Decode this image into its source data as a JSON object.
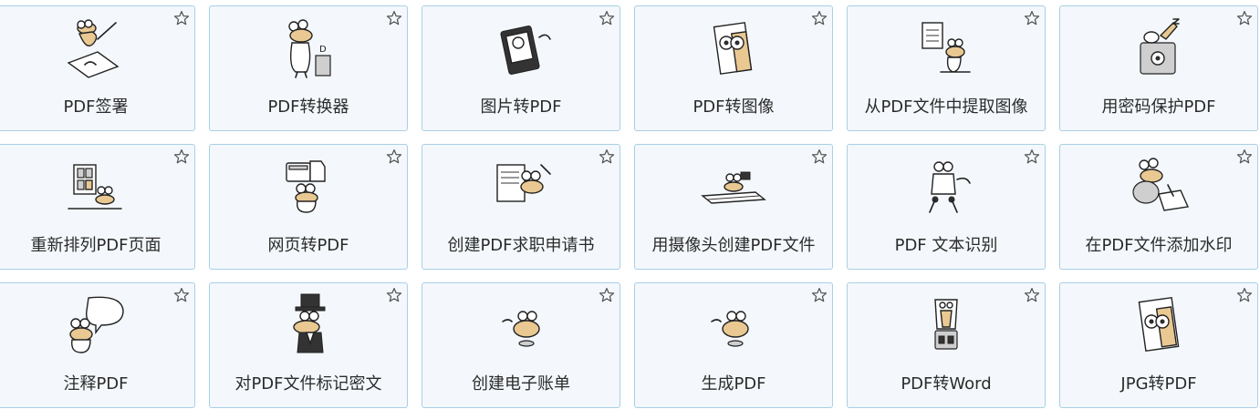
{
  "tools": [
    {
      "label": "PDF签署",
      "icon": "pdf-sign-icon"
    },
    {
      "label": "PDF转换器",
      "icon": "pdf-converter-icon"
    },
    {
      "label": "图片转PDF",
      "icon": "image-to-pdf-icon"
    },
    {
      "label": "PDF转图像",
      "icon": "pdf-to-image-icon"
    },
    {
      "label": "从PDF文件中提取图像",
      "icon": "extract-images-icon"
    },
    {
      "label": "用密码保护PDF",
      "icon": "password-protect-icon"
    },
    {
      "label": "重新排列PDF页面",
      "icon": "rearrange-pages-icon"
    },
    {
      "label": "网页转PDF",
      "icon": "webpage-to-pdf-icon"
    },
    {
      "label": "创建PDF求职申请书",
      "icon": "job-application-icon"
    },
    {
      "label": "用摄像头创建PDF文件",
      "icon": "webcam-pdf-icon"
    },
    {
      "label": "PDF 文本识别",
      "icon": "ocr-icon"
    },
    {
      "label": "在PDF文件添加水印",
      "icon": "watermark-icon"
    },
    {
      "label": "注释PDF",
      "icon": "annotate-icon"
    },
    {
      "label": "对PDF文件标记密文",
      "icon": "redact-icon"
    },
    {
      "label": "创建电子账单",
      "icon": "create-invoice-icon"
    },
    {
      "label": "生成PDF",
      "icon": "generate-pdf-icon"
    },
    {
      "label": "PDF转Word",
      "icon": "pdf-to-word-icon"
    },
    {
      "label": "JPG转PDF",
      "icon": "jpg-to-pdf-icon"
    }
  ],
  "favorite_icon": "star-outline-icon",
  "colors": {
    "card_bg": "#f4f8fc",
    "card_border": "#a9cfe6",
    "text": "#2b2b2b",
    "skin": "#e9c892"
  }
}
